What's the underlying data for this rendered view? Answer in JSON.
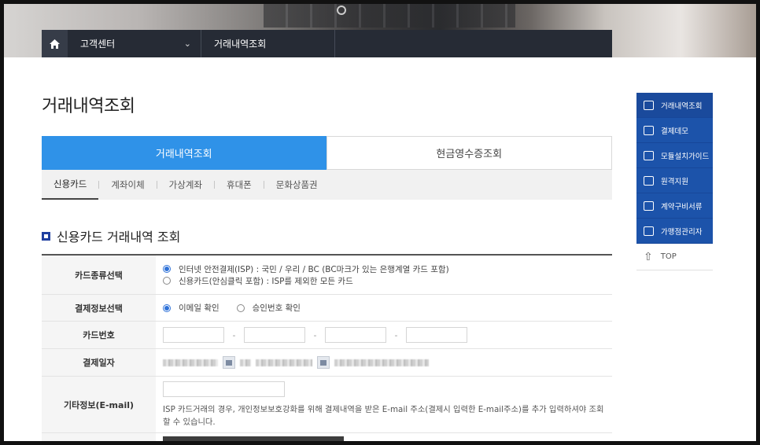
{
  "header": {
    "home_icon": "home-icon",
    "menu1": "고객센터",
    "menu2": "거래내역조회",
    "chevron_icon": "chevron-down-icon"
  },
  "page": {
    "title": "거래내역조회"
  },
  "tabs": [
    {
      "label": "거래내역조회",
      "active": true
    },
    {
      "label": "현금영수증조회",
      "active": false
    }
  ],
  "subtabs": [
    "신용카드",
    "계좌이체",
    "가상계좌",
    "휴대폰",
    "문화상품권"
  ],
  "section": {
    "title": "신용카드 거래내역 조회"
  },
  "form": {
    "card_type": {
      "label": "카드종류선택",
      "options": [
        "인터넷 안전결제(ISP) : 국민 / 우리 / BC (BC마크가 있는 은행계열 카드 포함)",
        "신용카드(안심클릭 포함) : ISP를 제외한 모든 카드"
      ],
      "selected": 0
    },
    "pay_info": {
      "label": "결제정보선택",
      "options": [
        "이메일 확인",
        "승인번호 확인"
      ],
      "selected": 0
    },
    "card_number": {
      "label": "카드번호",
      "sep": "-"
    },
    "pay_date": {
      "label": "결제일자"
    },
    "extra": {
      "label": "기타정보(E-mail)",
      "note": "ISP 카드거래의 경우, 개인정보보호강화를 위해 결제내역을 받은 E-mail 주소(결제시 입력한 E-mail주소)를 추가 입력하셔야 조회할 수 있습니다."
    }
  },
  "quick_menu": {
    "items": [
      {
        "label": "거래내역조회",
        "icon": "search-doc-icon"
      },
      {
        "label": "결제데모",
        "icon": "card-icon"
      },
      {
        "label": "모듈설치가이드",
        "icon": "monitor-icon"
      },
      {
        "label": "원격지원",
        "icon": "remote-icon"
      },
      {
        "label": "계약구비서류",
        "icon": "document-icon"
      },
      {
        "label": "가맹점관리자",
        "icon": "building-icon"
      }
    ],
    "top_label": "TOP",
    "top_icon": "arrow-up-icon"
  }
}
